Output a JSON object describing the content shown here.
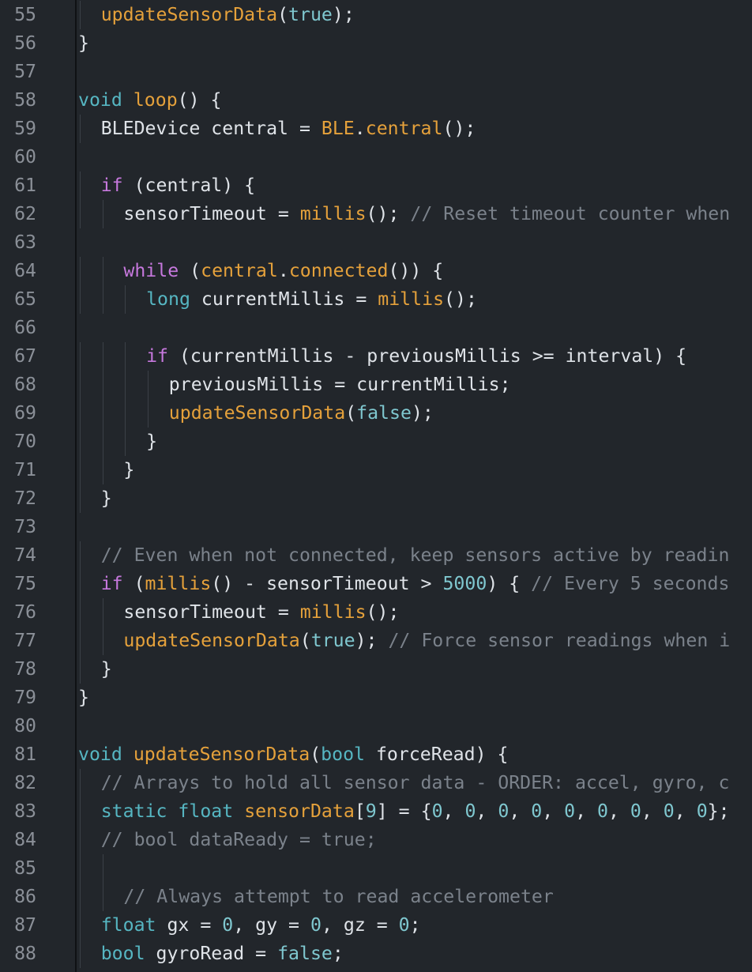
{
  "colors": {
    "background": "#22262b",
    "line_number": "#8b9098",
    "text": "#dfe3e8",
    "keyword": "#c678dd",
    "type": "#56b6c2",
    "function": "#e5a13b",
    "literal": "#7fc7cf",
    "number": "#7fc7cf",
    "comment": "#7b828b"
  },
  "lines": [
    {
      "n": "55",
      "indent": 1,
      "tokens": [
        [
          "fn",
          "updateSensorData"
        ],
        [
          "txt",
          "("
        ],
        [
          "lit",
          "true"
        ],
        [
          "txt",
          ");"
        ]
      ]
    },
    {
      "n": "56",
      "indent": 0,
      "tokens": [
        [
          "txt",
          "}"
        ]
      ]
    },
    {
      "n": "57",
      "indent": 0,
      "tokens": []
    },
    {
      "n": "58",
      "indent": 0,
      "tokens": [
        [
          "type",
          "void"
        ],
        [
          "txt",
          " "
        ],
        [
          "fn",
          "loop"
        ],
        [
          "txt",
          "() {"
        ]
      ]
    },
    {
      "n": "59",
      "indent": 1,
      "tokens": [
        [
          "txt",
          "BLEDevice central = "
        ],
        [
          "fn",
          "BLE"
        ],
        [
          "txt",
          "."
        ],
        [
          "fn",
          "central"
        ],
        [
          "txt",
          "();"
        ]
      ]
    },
    {
      "n": "60",
      "indent": 0,
      "tokens": []
    },
    {
      "n": "61",
      "indent": 1,
      "tokens": [
        [
          "kw",
          "if"
        ],
        [
          "txt",
          " (central) {"
        ]
      ]
    },
    {
      "n": "62",
      "indent": 2,
      "tokens": [
        [
          "txt",
          "sensorTimeout = "
        ],
        [
          "fn",
          "millis"
        ],
        [
          "txt",
          "(); "
        ],
        [
          "cmt",
          "// Reset timeout counter when"
        ]
      ]
    },
    {
      "n": "63",
      "indent": 0,
      "tokens": []
    },
    {
      "n": "64",
      "indent": 2,
      "tokens": [
        [
          "kw",
          "while"
        ],
        [
          "txt",
          " ("
        ],
        [
          "fn",
          "central"
        ],
        [
          "txt",
          "."
        ],
        [
          "fn",
          "connected"
        ],
        [
          "txt",
          "()) {"
        ]
      ]
    },
    {
      "n": "65",
      "indent": 3,
      "tokens": [
        [
          "type",
          "long"
        ],
        [
          "txt",
          " currentMillis = "
        ],
        [
          "fn",
          "millis"
        ],
        [
          "txt",
          "();"
        ]
      ]
    },
    {
      "n": "66",
      "indent": 0,
      "tokens": []
    },
    {
      "n": "67",
      "indent": 3,
      "tokens": [
        [
          "kw",
          "if"
        ],
        [
          "txt",
          " (currentMillis - previousMillis >= interval) {"
        ]
      ]
    },
    {
      "n": "68",
      "indent": 4,
      "tokens": [
        [
          "txt",
          "previousMillis = currentMillis;"
        ]
      ]
    },
    {
      "n": "69",
      "indent": 4,
      "tokens": [
        [
          "fn",
          "updateSensorData"
        ],
        [
          "txt",
          "("
        ],
        [
          "lit",
          "false"
        ],
        [
          "txt",
          ");"
        ]
      ]
    },
    {
      "n": "70",
      "indent": 3,
      "tokens": [
        [
          "txt",
          "}"
        ]
      ]
    },
    {
      "n": "71",
      "indent": 2,
      "tokens": [
        [
          "txt",
          "}"
        ]
      ]
    },
    {
      "n": "72",
      "indent": 1,
      "tokens": [
        [
          "txt",
          "}"
        ]
      ]
    },
    {
      "n": "73",
      "indent": 0,
      "tokens": []
    },
    {
      "n": "74",
      "indent": 1,
      "tokens": [
        [
          "cmt",
          "// Even when not connected, keep sensors active by readin"
        ]
      ]
    },
    {
      "n": "75",
      "indent": 1,
      "tokens": [
        [
          "kw",
          "if"
        ],
        [
          "txt",
          " ("
        ],
        [
          "fn",
          "millis"
        ],
        [
          "txt",
          "() - sensorTimeout > "
        ],
        [
          "num",
          "5000"
        ],
        [
          "txt",
          ") { "
        ],
        [
          "cmt",
          "// Every 5 seconds"
        ]
      ]
    },
    {
      "n": "76",
      "indent": 2,
      "tokens": [
        [
          "txt",
          "sensorTimeout = "
        ],
        [
          "fn",
          "millis"
        ],
        [
          "txt",
          "();"
        ]
      ]
    },
    {
      "n": "77",
      "indent": 2,
      "tokens": [
        [
          "fn",
          "updateSensorData"
        ],
        [
          "txt",
          "("
        ],
        [
          "lit",
          "true"
        ],
        [
          "txt",
          "); "
        ],
        [
          "cmt",
          "// Force sensor readings when i"
        ]
      ]
    },
    {
      "n": "78",
      "indent": 1,
      "tokens": [
        [
          "txt",
          "}"
        ]
      ]
    },
    {
      "n": "79",
      "indent": 0,
      "tokens": [
        [
          "txt",
          "}"
        ]
      ]
    },
    {
      "n": "80",
      "indent": 0,
      "tokens": []
    },
    {
      "n": "81",
      "indent": 0,
      "tokens": [
        [
          "type",
          "void"
        ],
        [
          "txt",
          " "
        ],
        [
          "fn",
          "updateSensorData"
        ],
        [
          "txt",
          "("
        ],
        [
          "type",
          "bool"
        ],
        [
          "txt",
          " forceRead) {"
        ]
      ]
    },
    {
      "n": "82",
      "indent": 1,
      "tokens": [
        [
          "cmt",
          "// Arrays to hold all sensor data - ORDER: accel, gyro, c"
        ]
      ]
    },
    {
      "n": "83",
      "indent": 1,
      "tokens": [
        [
          "type",
          "static"
        ],
        [
          "txt",
          " "
        ],
        [
          "type",
          "float"
        ],
        [
          "txt",
          " "
        ],
        [
          "fn",
          "sensorData"
        ],
        [
          "txt",
          "["
        ],
        [
          "num",
          "9"
        ],
        [
          "txt",
          "] = {"
        ],
        [
          "num",
          "0"
        ],
        [
          "txt",
          ", "
        ],
        [
          "num",
          "0"
        ],
        [
          "txt",
          ", "
        ],
        [
          "num",
          "0"
        ],
        [
          "txt",
          ", "
        ],
        [
          "num",
          "0"
        ],
        [
          "txt",
          ", "
        ],
        [
          "num",
          "0"
        ],
        [
          "txt",
          ", "
        ],
        [
          "num",
          "0"
        ],
        [
          "txt",
          ", "
        ],
        [
          "num",
          "0"
        ],
        [
          "txt",
          ", "
        ],
        [
          "num",
          "0"
        ],
        [
          "txt",
          ", "
        ],
        [
          "num",
          "0"
        ],
        [
          "txt",
          "};"
        ]
      ]
    },
    {
      "n": "84",
      "indent": 1,
      "tokens": [
        [
          "cmt",
          "// bool dataReady = true;"
        ]
      ]
    },
    {
      "n": "85",
      "indent": 2,
      "tokens": []
    },
    {
      "n": "86",
      "indent": 2,
      "tokens": [
        [
          "cmt",
          "// Always attempt to read accelerometer"
        ]
      ]
    },
    {
      "n": "87",
      "indent": 1,
      "tokens": [
        [
          "type",
          "float"
        ],
        [
          "txt",
          " gx = "
        ],
        [
          "num",
          "0"
        ],
        [
          "txt",
          ", gy = "
        ],
        [
          "num",
          "0"
        ],
        [
          "txt",
          ", gz = "
        ],
        [
          "num",
          "0"
        ],
        [
          "txt",
          ";"
        ]
      ]
    },
    {
      "n": "88",
      "indent": 1,
      "tokens": [
        [
          "type",
          "bool"
        ],
        [
          "txt",
          " gyroRead = "
        ],
        [
          "lit",
          "false"
        ],
        [
          "txt",
          ";"
        ]
      ]
    }
  ]
}
